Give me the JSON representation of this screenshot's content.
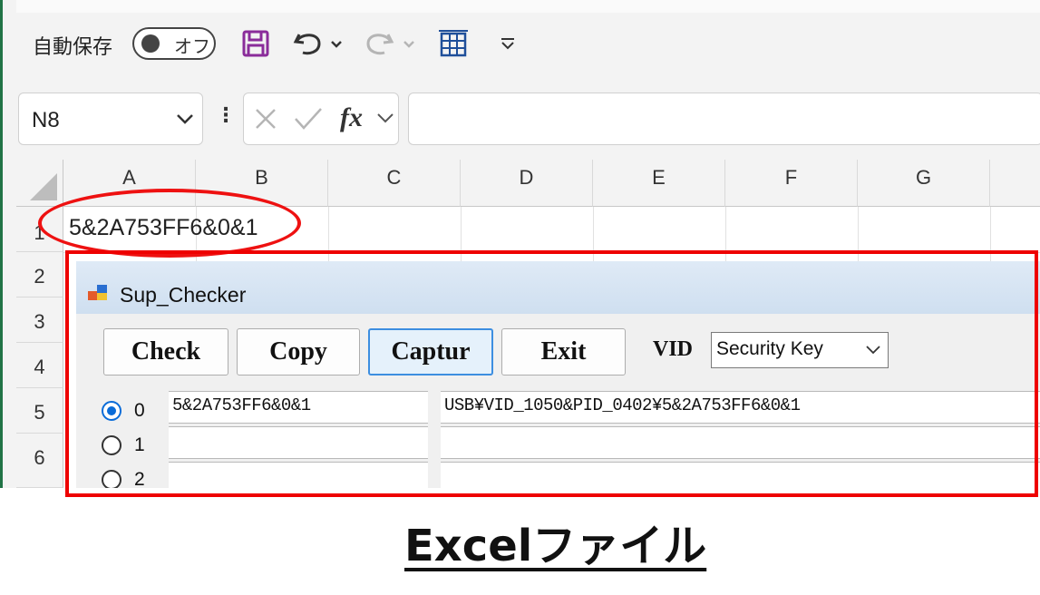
{
  "excel": {
    "ribbon_cut_text": "",
    "autosave_label": "自動保存",
    "autosave_state": "オフ",
    "namebox": "N8",
    "fx_label": "fx",
    "formula_value": "",
    "columns": [
      "A",
      "B",
      "C",
      "D",
      "E",
      "F",
      "G"
    ],
    "rows": [
      "1",
      "2",
      "3",
      "4",
      "5",
      "6"
    ],
    "cell_a1": "5&2A753FF6&0&1"
  },
  "dialog": {
    "title": "Sup_Checker",
    "buttons": {
      "check": "Check",
      "copy": "Copy",
      "capture": "Captur",
      "exit": "Exit"
    },
    "vid_label": "VID",
    "vid_selected": "Security Key",
    "radio_options": [
      "0",
      "1",
      "2"
    ],
    "selected_radio": "0",
    "rows": [
      {
        "id": "5&2A753FF6&0&1",
        "path": "USB¥VID_1050&PID_0402¥5&2A753FF6&0&1"
      },
      {
        "id": "",
        "path": ""
      },
      {
        "id": "",
        "path": ""
      }
    ]
  },
  "annotation": {
    "caption": "Excelファイル",
    "highlight_color": "#e00000"
  }
}
